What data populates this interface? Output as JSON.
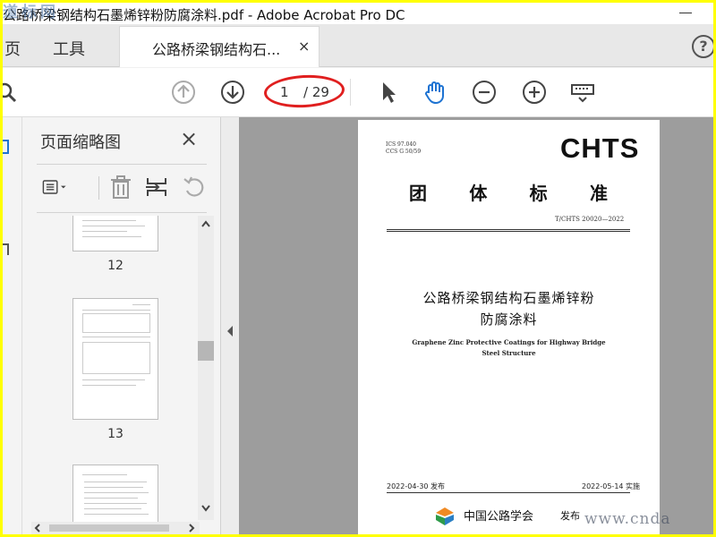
{
  "window": {
    "title": "公路桥梁钢结构石墨烯锌粉防腐涂料.pdf - Adobe Acrobat Pro DC",
    "watermark_top": "道标网",
    "watermark_bottom": "www.cnda"
  },
  "tabs": {
    "home": "页",
    "tools": "工具",
    "document": "公路桥梁钢结构石...",
    "close_glyph": "×",
    "help_glyph": "?"
  },
  "toolbar": {
    "current_page": "1",
    "total_pages": "/ 29",
    "icons": [
      "search-icon",
      "page-up-icon",
      "page-down-icon",
      "select-cursor-icon",
      "hand-tool-icon",
      "zoom-out-icon",
      "zoom-in-icon",
      "keyboard-icon"
    ]
  },
  "thumbnail_panel": {
    "title": "页面缩略图",
    "close_glyph": "×",
    "tool_icons": [
      "page-options-icon",
      "delete-page-icon",
      "insert-page-icon",
      "rotate-page-icon"
    ],
    "thumbnails": [
      {
        "label": "12"
      },
      {
        "label": "13"
      },
      {
        "label": ""
      }
    ]
  },
  "document": {
    "meta": [
      "ICS 97.040",
      "CCS G 50/59"
    ],
    "brand": "CHTS",
    "header_chars": [
      "团",
      "体",
      "标",
      "准"
    ],
    "code": "T/CHTS 20020—2022",
    "title_cn_line1": "公路桥梁钢结构石墨烯锌粉",
    "title_cn_line2": "防腐涂料",
    "title_en_line1": "Graphene Zinc Protective Coatings for Highway Bridge",
    "title_en_line2": "Steel Structure",
    "release_date": "2022-04-30 发布",
    "effective_date": "2022-05-14 实施",
    "organization": "中国公路学会",
    "publish_word": "发布"
  },
  "colors": {
    "accent": "#1e73d2",
    "annotation": "#e01f1f",
    "frame": "#ffff00",
    "logo_green": "#2e9b4a",
    "logo_orange": "#f08a24"
  }
}
